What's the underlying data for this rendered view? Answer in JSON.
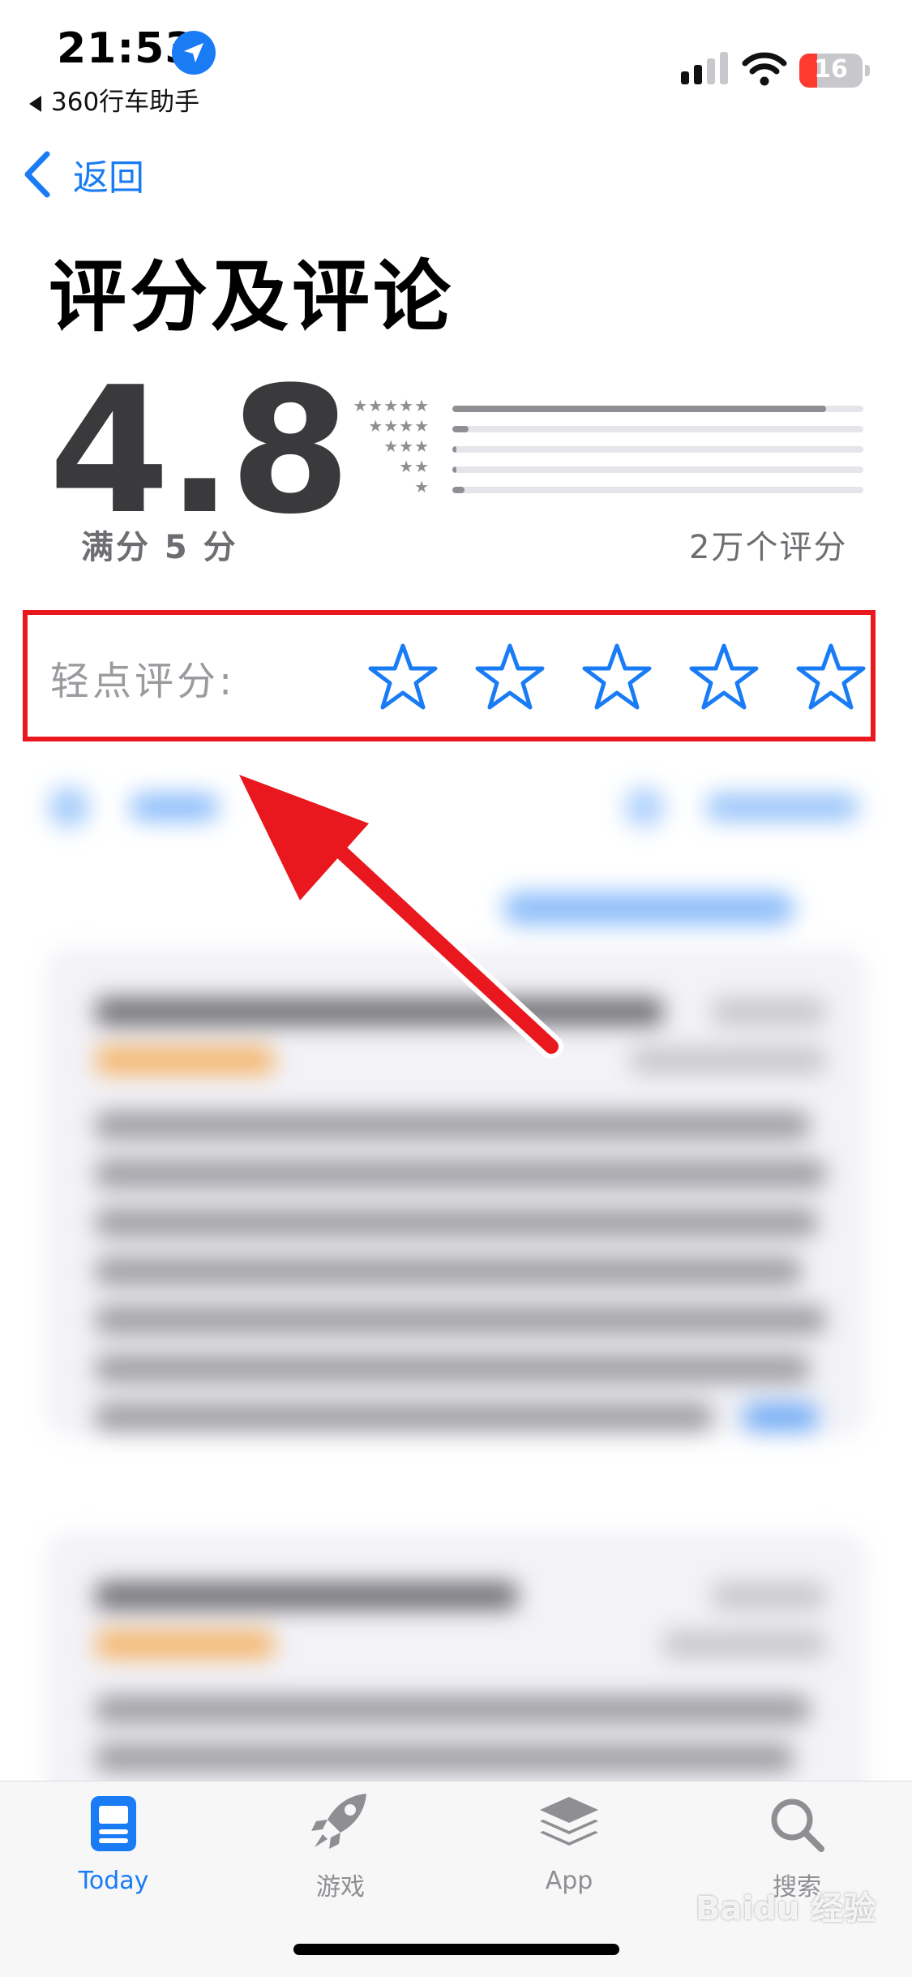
{
  "status": {
    "time": "21:53",
    "back_app": "360行车助手",
    "battery": "16"
  },
  "nav": {
    "back_label": "返回"
  },
  "page": {
    "title": "评分及评论"
  },
  "ratings": {
    "score": "4.8",
    "out_of": "满分 5 分",
    "total": "2万个评分",
    "histogram": [
      {
        "stars": "★★★★★",
        "fraction": 0.91
      },
      {
        "stars": "★★★★",
        "fraction": 0.04
      },
      {
        "stars": "★★★",
        "fraction": 0.01
      },
      {
        "stars": "★★",
        "fraction": 0.01
      },
      {
        "stars": "★",
        "fraction": 0.03
      }
    ]
  },
  "tap_to_rate": {
    "label": "轻点评分:",
    "star_color": "#1a7cf5"
  },
  "annotation": {
    "box_color": "#e8181e",
    "arrow_color": "#e8181e"
  },
  "tabbar": {
    "tabs": [
      {
        "label": "Today",
        "icon": "today-icon",
        "active": true
      },
      {
        "label": "游戏",
        "icon": "rocket-icon",
        "active": false
      },
      {
        "label": "App",
        "icon": "app-layers-icon",
        "active": false
      },
      {
        "label": "搜索",
        "icon": "search-icon",
        "active": false
      }
    ]
  },
  "watermark": "Baidu 经验"
}
